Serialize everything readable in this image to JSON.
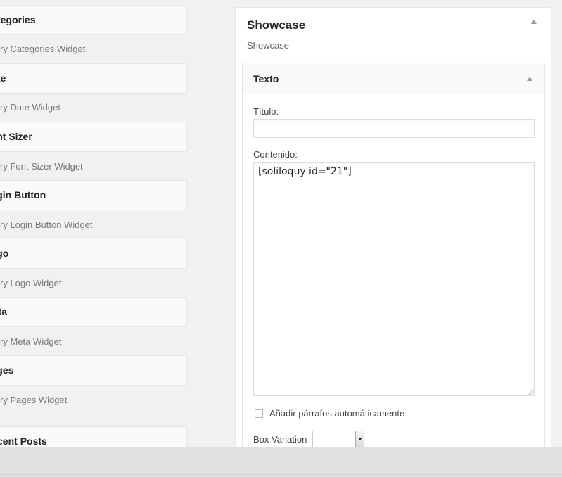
{
  "available_widgets": [
    {
      "title": "ry Categories",
      "description": "ry Categories Widget"
    },
    {
      "title": "ry Date",
      "description": "ry Date Widget"
    },
    {
      "title": "ry Font Sizer",
      "description": "ry Font Sizer Widget"
    },
    {
      "title": "ry Login Button",
      "description": "ry Login Button Widget"
    },
    {
      "title": "ry Logo",
      "description": "ry Logo Widget"
    },
    {
      "title": "ry Meta",
      "description": "ry Meta Widget"
    },
    {
      "title": "ry Pages",
      "description": "ry Pages Widget"
    },
    {
      "title": "ry Recent Posts",
      "description": ""
    }
  ],
  "sidebar": {
    "name": "Showcase",
    "description": "Showcase",
    "toggle_icon": "arrow-up-icon",
    "widget": {
      "title": "Texto",
      "toggle_icon": "arrow-up-icon",
      "title_field": {
        "label": "Título:",
        "value": ""
      },
      "content_field": {
        "label": "Contenido:",
        "value": "[soliloquy id=\"21\"]"
      },
      "auto_paragraph": {
        "label": "Añadir párrafos automáticamente",
        "checked": false
      },
      "box_variation": {
        "label": "Box Variation",
        "value": "-"
      }
    }
  },
  "colors": {
    "background": "#f1f1f1",
    "panel": "#ffffff",
    "header": "#fafafa",
    "border": "#e5e5e5",
    "bottom_bar": "#e0e0e0"
  }
}
